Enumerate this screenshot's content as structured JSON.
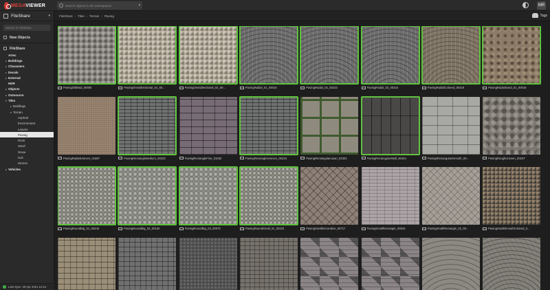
{
  "app": {
    "logo_red": "MEGA",
    "logo_white": "VIEWER",
    "search_placeholder": "Search objects in all namespaces",
    "avatar_initials": "MR"
  },
  "sidebar": {
    "title": "FileShare",
    "search_placeholder": "Search in FileShare",
    "new_objects_label": "New Objects",
    "fileshare_label": "FileShare",
    "tree": [
      {
        "label": "Artec",
        "level": 0,
        "arrow": "",
        "bold": true
      },
      {
        "label": "Buildings",
        "level": 0,
        "arrow": "▸",
        "bold": true
      },
      {
        "label": "Characters",
        "level": 0,
        "arrow": "▸",
        "bold": true
      },
      {
        "label": "Decals",
        "level": 0,
        "arrow": "▸",
        "bold": true
      },
      {
        "label": "External",
        "level": 0,
        "arrow": "▸",
        "bold": true
      },
      {
        "label": "HDR",
        "level": 0,
        "arrow": "",
        "bold": true
      },
      {
        "label": "Objects",
        "level": 0,
        "arrow": "▸",
        "bold": true
      },
      {
        "label": "Outsource",
        "level": 0,
        "arrow": "▸",
        "bold": true
      },
      {
        "label": "Tiles",
        "level": 0,
        "arrow": "▾",
        "bold": true
      },
      {
        "label": "Buildings",
        "level": 1,
        "arrow": "▸",
        "bold": false
      },
      {
        "label": "Terrain",
        "level": 1,
        "arrow": "▾",
        "bold": false
      },
      {
        "label": "Asphalt",
        "level": 2,
        "arrow": "",
        "bold": false
      },
      {
        "label": "Environment",
        "level": 2,
        "arrow": "",
        "bold": false
      },
      {
        "label": "Leaves",
        "level": 2,
        "arrow": "",
        "bold": false
      },
      {
        "label": "Paving",
        "level": 2,
        "arrow": "",
        "bold": false,
        "active": true
      },
      {
        "label": "Rock",
        "level": 2,
        "arrow": "",
        "bold": false
      },
      {
        "label": "Sand",
        "level": 2,
        "arrow": "",
        "bold": false
      },
      {
        "label": "Snow",
        "level": 2,
        "arrow": "",
        "bold": false
      },
      {
        "label": "Soil",
        "level": 2,
        "arrow": "",
        "bold": false
      },
      {
        "label": "Stones",
        "level": 2,
        "arrow": "",
        "bold": false
      },
      {
        "label": "Vehicles",
        "level": 0,
        "arrow": "▸",
        "bold": true
      }
    ],
    "footer_status": "Last Sync: 29 Apr 2021 12:34"
  },
  "breadcrumb": [
    "FileShare",
    "Tiles",
    "Terrain",
    "Paving"
  ],
  "tags_label": "Tags",
  "colors": {
    "selection": "#5fc43e",
    "sync_ok": "#3fb24a",
    "brand_red": "#e0413a"
  },
  "tiles": [
    {
      "name": "PavingOldMud_00008",
      "selected": true,
      "tex": "tex-cobble"
    },
    {
      "name": "PavingOmnidirectional_01_00...",
      "selected": true,
      "tex": "tex-cobble-light"
    },
    {
      "name": "PavingOmnidirectional_02_00...",
      "selected": true,
      "tex": "tex-cobble-light"
    },
    {
      "name": "PavingRadial_01_00015",
      "selected": true,
      "tex": "tex-radial"
    },
    {
      "name": "PavingRadial_02_00223",
      "selected": true,
      "tex": "tex-radial"
    },
    {
      "name": "PavingRadial_03_00224",
      "selected": true,
      "tex": "tex-radial"
    },
    {
      "name": "PavingRadialColored_00219",
      "selected": true,
      "tex": "tex-radial-warm"
    },
    {
      "name": "PavingRadialSand_01_00018",
      "selected": true,
      "tex": "tex-sand"
    },
    {
      "name": "PavingRadialUneven_01687",
      "selected": false,
      "tex": "tex-dirt"
    },
    {
      "name": "PavingRectangleMedium_00222",
      "selected": true,
      "tex": "tex-rect"
    },
    {
      "name": "PavingRectangleFine_01532",
      "selected": false,
      "tex": "tex-brick-purple"
    },
    {
      "name": "PavingRectangleUneven_00216",
      "selected": true,
      "tex": "tex-rect"
    },
    {
      "name": "PavingRectangularLawn_02324",
      "selected": false,
      "tex": "tex-grass-slab"
    },
    {
      "name": "PavingRectangularWall_00444",
      "selected": true,
      "tex": "tex-brick-dark"
    },
    {
      "name": "PavingRectangularSmooth_00...",
      "selected": false,
      "tex": "tex-slab-light"
    },
    {
      "name": "PavingRoughUneven_00197",
      "selected": false,
      "tex": "tex-rough"
    },
    {
      "name": "PavingRoundBig_01_00440",
      "selected": true,
      "tex": "tex-round"
    },
    {
      "name": "PavingRoundBig_02_00138",
      "selected": true,
      "tex": "tex-round-b"
    },
    {
      "name": "PavingRoundBig_03_00070",
      "selected": true,
      "tex": "tex-round-b"
    },
    {
      "name": "PavingRoundSmall_01_00103",
      "selected": true,
      "tex": "tex-round"
    },
    {
      "name": "PavingSmallDecorative_00717",
      "selected": false,
      "tex": "tex-diag"
    },
    {
      "name": "PavingSmallRectangle_00542",
      "selected": false,
      "tex": "tex-small-rect"
    },
    {
      "name": "PavingSmallRectangle_02_00...",
      "selected": false,
      "tex": "tex-small-rect2"
    },
    {
      "name": "PavingSmallSmoothColored_0...",
      "selected": false,
      "tex": "tex-colored"
    },
    {
      "name": "",
      "selected": false,
      "tex": "tex-sett-warm"
    },
    {
      "name": "",
      "selected": false,
      "tex": "tex-sett-grey"
    },
    {
      "name": "",
      "selected": false,
      "tex": "tex-sett-dark"
    },
    {
      "name": "",
      "selected": false,
      "tex": "tex-sett-mixed"
    },
    {
      "name": "",
      "selected": false,
      "tex": "tex-pattern"
    },
    {
      "name": "",
      "selected": false,
      "tex": "tex-pattern"
    },
    {
      "name": "",
      "selected": false,
      "tex": "tex-fan"
    },
    {
      "name": "",
      "selected": false,
      "tex": "tex-fan-dark"
    }
  ]
}
